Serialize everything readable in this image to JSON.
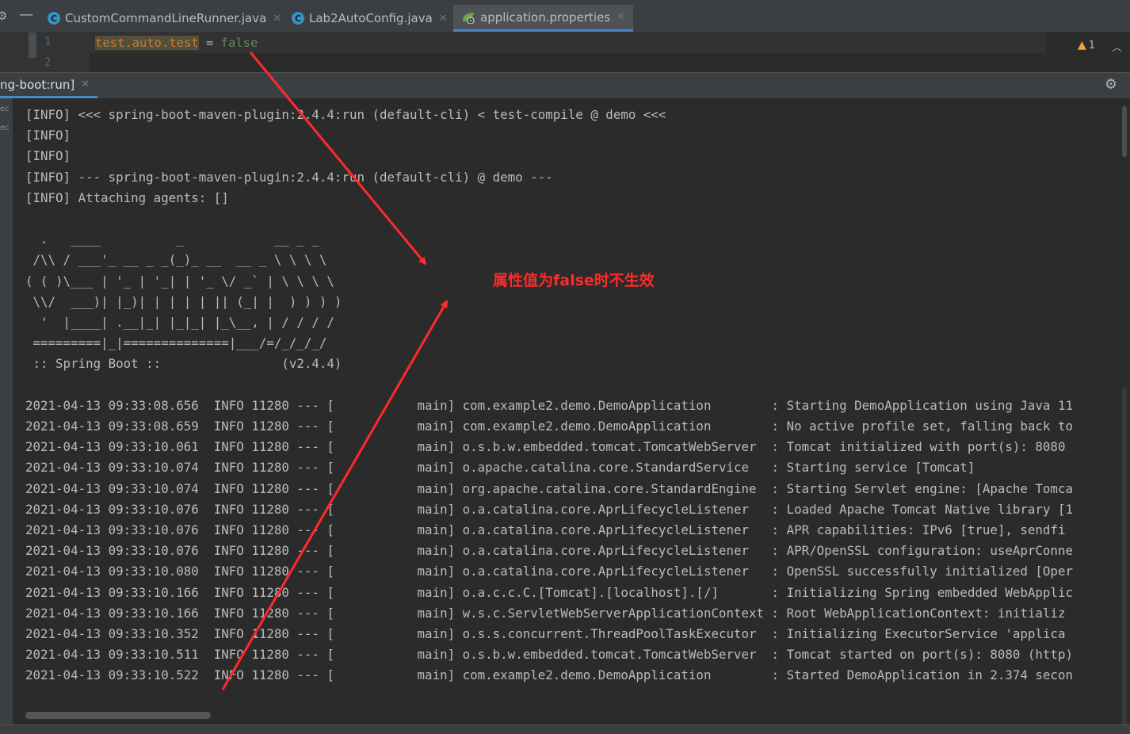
{
  "editor_tabs": [
    {
      "label": "CustomCommandLineRunner.java",
      "icon": "java-class-icon",
      "active": false
    },
    {
      "label": "Lab2AutoConfig.java",
      "icon": "java-class-icon",
      "active": false
    },
    {
      "label": "application.properties",
      "icon": "spring-properties-icon",
      "active": true
    }
  ],
  "editor": {
    "line_numbers": [
      "1",
      "2"
    ],
    "line1": {
      "key": "test.auto.test",
      "eq": " = ",
      "value": "false"
    },
    "warning_count": "1"
  },
  "run_window": {
    "tab_label": "ng-boot:run]"
  },
  "console": {
    "lines": [
      "[INFO] <<< spring-boot-maven-plugin:2.4.4:run (default-cli) < test-compile @ demo <<<",
      "[INFO]",
      "[INFO]",
      "[INFO] --- spring-boot-maven-plugin:2.4.4:run (default-cli) @ demo ---",
      "[INFO] Attaching agents: []",
      "",
      "  .   ____          _            __ _ _",
      " /\\\\ / ___'_ __ _ _(_)_ __  __ _ \\ \\ \\ \\",
      "( ( )\\___ | '_ | '_| | '_ \\/ _` | \\ \\ \\ \\",
      " \\\\/  ___)| |_)| | | | | || (_| |  ) ) ) )",
      "  '  |____| .__|_| |_|_| |_\\__, | / / / /",
      " =========|_|==============|___/=/_/_/_/",
      " :: Spring Boot ::                (v2.4.4)",
      "",
      "2021-04-13 09:33:08.656  INFO 11280 --- [           main] com.example2.demo.DemoApplication        : Starting DemoApplication using Java 11",
      "2021-04-13 09:33:08.659  INFO 11280 --- [           main] com.example2.demo.DemoApplication        : No active profile set, falling back to",
      "2021-04-13 09:33:10.061  INFO 11280 --- [           main] o.s.b.w.embedded.tomcat.TomcatWebServer  : Tomcat initialized with port(s): 8080",
      "2021-04-13 09:33:10.074  INFO 11280 --- [           main] o.apache.catalina.core.StandardService   : Starting service [Tomcat]",
      "2021-04-13 09:33:10.074  INFO 11280 --- [           main] org.apache.catalina.core.StandardEngine  : Starting Servlet engine: [Apache Tomca",
      "2021-04-13 09:33:10.076  INFO 11280 --- [           main] o.a.catalina.core.AprLifecycleListener   : Loaded Apache Tomcat Native library [1",
      "2021-04-13 09:33:10.076  INFO 11280 --- [           main] o.a.catalina.core.AprLifecycleListener   : APR capabilities: IPv6 [true], sendfi",
      "2021-04-13 09:33:10.076  INFO 11280 --- [           main] o.a.catalina.core.AprLifecycleListener   : APR/OpenSSL configuration: useAprConne",
      "2021-04-13 09:33:10.080  INFO 11280 --- [           main] o.a.catalina.core.AprLifecycleListener   : OpenSSL successfully initialized [Oper",
      "2021-04-13 09:33:10.166  INFO 11280 --- [           main] o.a.c.c.C.[Tomcat].[localhost].[/]       : Initializing Spring embedded WebApplic",
      "2021-04-13 09:33:10.166  INFO 11280 --- [           main] w.s.c.ServletWebServerApplicationContext : Root WebApplicationContext: initializ",
      "2021-04-13 09:33:10.352  INFO 11280 --- [           main] o.s.s.concurrent.ThreadPoolTaskExecutor  : Initializing ExecutorService 'applica",
      "2021-04-13 09:33:10.511  INFO 11280 --- [           main] o.s.b.w.embedded.tomcat.TomcatWebServer  : Tomcat started on port(s): 8080 (http)",
      "2021-04-13 09:33:10.522  INFO 11280 --- [           main] com.example2.demo.DemoApplication        : Started DemoApplication in 2.374 secon"
    ]
  },
  "annotation": {
    "text": "属性值为false时不生效",
    "color": "#ff2a2a"
  },
  "colors": {
    "accent": "#4a88c7",
    "key": "#cc7832",
    "string": "#6a8759"
  }
}
